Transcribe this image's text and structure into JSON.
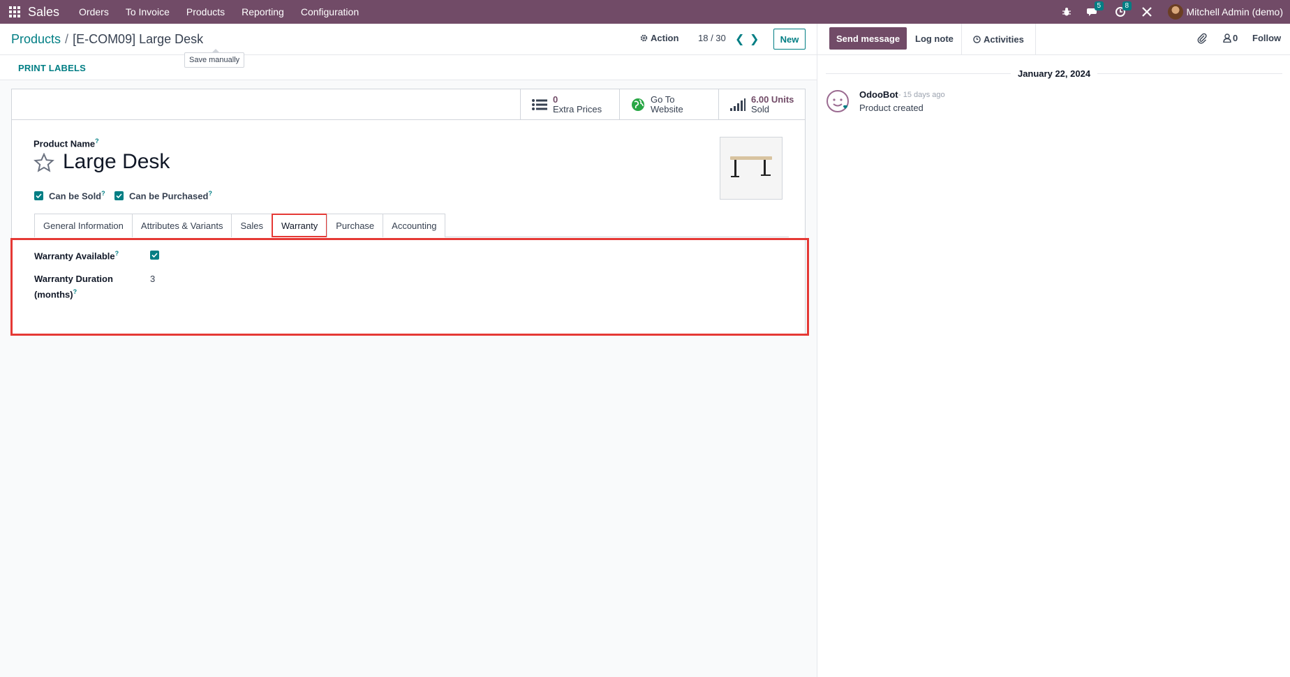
{
  "navbar": {
    "app_name": "Sales",
    "menu": [
      "Orders",
      "To Invoice",
      "Products",
      "Reporting",
      "Configuration"
    ],
    "messages_count": "5",
    "activities_count": "8",
    "user_name": "Mitchell Admin (demo)"
  },
  "control": {
    "breadcrumb_parent": "Products",
    "breadcrumb_separator": "/",
    "breadcrumb_current": "[E-COM09] Large Desk",
    "save_tooltip": "Save manually",
    "action_label": "Action",
    "pager": "18 / 30",
    "new_label": "New",
    "print_labels": "PRINT LABELS"
  },
  "stat_buttons": {
    "extra_prices_value": "0",
    "extra_prices_label": "Extra Prices",
    "website_line1": "Go To",
    "website_line2": "Website",
    "sold_value": "6.00 Units",
    "sold_label": "Sold"
  },
  "product": {
    "name_label": "Product Name",
    "help_mark": "?",
    "name": "Large Desk",
    "can_be_sold_label": "Can be Sold",
    "can_be_purchased_label": "Can be Purchased"
  },
  "tabs": [
    "General Information",
    "Attributes & Variants",
    "Sales",
    "Warranty",
    "Purchase",
    "Accounting"
  ],
  "active_tab": "Warranty",
  "warranty": {
    "available_label": "Warranty Available",
    "duration_label_line1": "Warranty Duration",
    "duration_label_line2": "(months)",
    "duration_value": "3"
  },
  "chatter": {
    "send_message": "Send message",
    "log_note": "Log note",
    "activities": "Activities",
    "followers_count": "0",
    "follow": "Follow",
    "date": "January 22, 2024",
    "author": "OdooBot",
    "time": "- 15 days ago",
    "body": "Product created"
  },
  "colors": {
    "brand": "#714B67",
    "accent": "#017e84",
    "highlight": "#e53935"
  }
}
